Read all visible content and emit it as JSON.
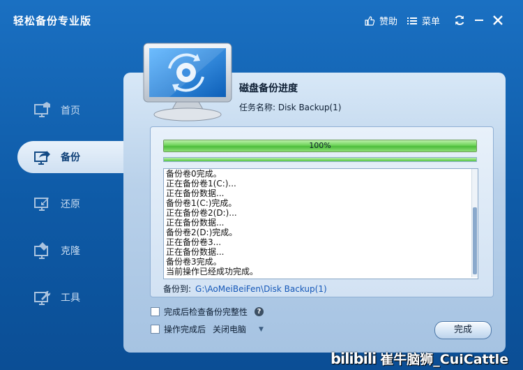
{
  "app": {
    "title": "轻松备份专业版"
  },
  "titlebar": {
    "like_label": "赞助",
    "menu_label": "菜单"
  },
  "nav": {
    "items": [
      {
        "label": "首页"
      },
      {
        "label": "备份"
      },
      {
        "label": "还原"
      },
      {
        "label": "克隆"
      },
      {
        "label": "工具"
      }
    ],
    "active_index": 1
  },
  "task": {
    "title": "磁盘备份进度",
    "name_label": "任务名称: Disk Backup(1)"
  },
  "progress": {
    "text": "100%",
    "fraction": 1.0,
    "secondary_fraction": 1.0
  },
  "log": {
    "lines": [
      "备份卷0完成。",
      "正在备份卷1(C:)...",
      "正在备份数据...",
      "备份卷1(C:)完成。",
      "正在备份卷2(D:)...",
      "正在备份数据...",
      "备份卷2(D:)完成。",
      "正在备份卷3...",
      "正在备份数据...",
      "备份卷3完成。",
      "当前操作已经成功完成。"
    ]
  },
  "destination": {
    "label": "备份到:",
    "path": "G:\\AoMeiBeiFen\\Disk Backup(1)"
  },
  "options": {
    "verify_label": "完成后检查备份完整性",
    "verify_help": "?",
    "after_label": "操作完成后",
    "after_value": "关闭电脑"
  },
  "buttons": {
    "finish": "完成"
  },
  "watermark": {
    "logo": "bilibili",
    "text": "崔牛脑狮_CuiCattle"
  },
  "colors": {
    "accent": "#0e5aa6",
    "panel": "#b9d1ea",
    "progress": "#4cbc3b",
    "path_link": "#1457b8"
  }
}
